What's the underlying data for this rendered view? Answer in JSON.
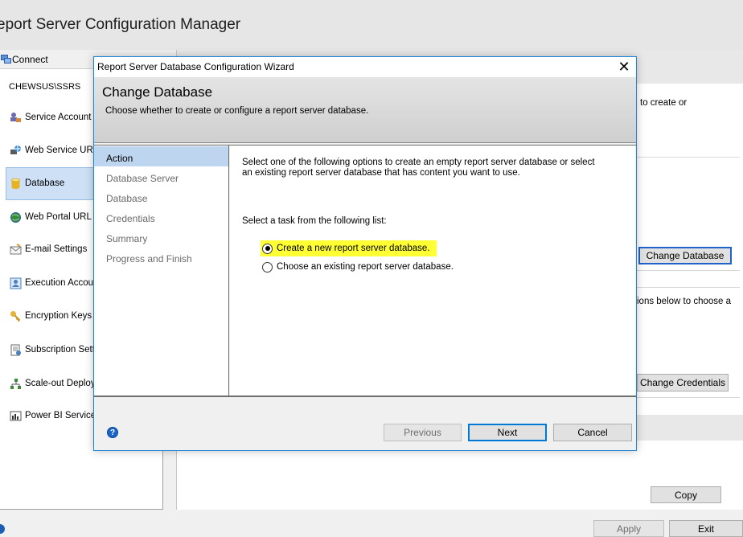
{
  "app": {
    "title": "eport Server Configuration Manager"
  },
  "sidebar": {
    "connect_label": "Connect",
    "server_name": "CHEWSUS\\SSRS",
    "items": [
      {
        "label": "Service Account",
        "icon": "service-account-icon"
      },
      {
        "label": "Web Service URL",
        "icon": "web-service-icon"
      },
      {
        "label": "Database",
        "icon": "database-icon",
        "selected": true
      },
      {
        "label": "Web Portal URL",
        "icon": "globe-icon"
      },
      {
        "label": "E-mail Settings",
        "icon": "email-icon"
      },
      {
        "label": "Execution Accoun",
        "icon": "execution-account-icon"
      },
      {
        "label": "Encryption Keys",
        "icon": "key-icon"
      },
      {
        "label": "Subscription Setti",
        "icon": "subscription-icon"
      },
      {
        "label": "Scale-out Deploym",
        "icon": "scale-out-icon"
      },
      {
        "label": "Power BI Service",
        "icon": "power-bi-icon"
      }
    ]
  },
  "main": {
    "text_1": "to create or",
    "text_2": "ions below to choose a",
    "change_database_button": "Change Database",
    "change_credentials_button": "Change Credentials",
    "copy_button": "Copy",
    "apply_button": "Apply",
    "exit_button": "Exit"
  },
  "dialog": {
    "title": "Report Server Database Configuration Wizard",
    "close_glyph": "✕",
    "heading": "Change Database",
    "subheading": "Choose whether to create or configure a report server database.",
    "steps": [
      "Action",
      "Database Server",
      "Database",
      "Credentials",
      "Summary",
      "Progress and Finish"
    ],
    "active_step": "Action",
    "intro_text": "Select one of the following options to create an empty report server database or select an existing report server database that has content you want to use.",
    "task_prompt": "Select a task from the following list:",
    "options": [
      {
        "label": "Create a new report server database.",
        "checked": true,
        "highlighted": true
      },
      {
        "label": "Choose an existing report server database.",
        "checked": false,
        "highlighted": false
      }
    ],
    "help_glyph": "?",
    "buttons": {
      "previous": "Previous",
      "next": "Next",
      "cancel": "Cancel"
    }
  },
  "colors": {
    "accent": "#0078d7",
    "highlight": "#ffff33",
    "active_step": "#bdd5ee",
    "selected_nav": "#cde0f5"
  }
}
